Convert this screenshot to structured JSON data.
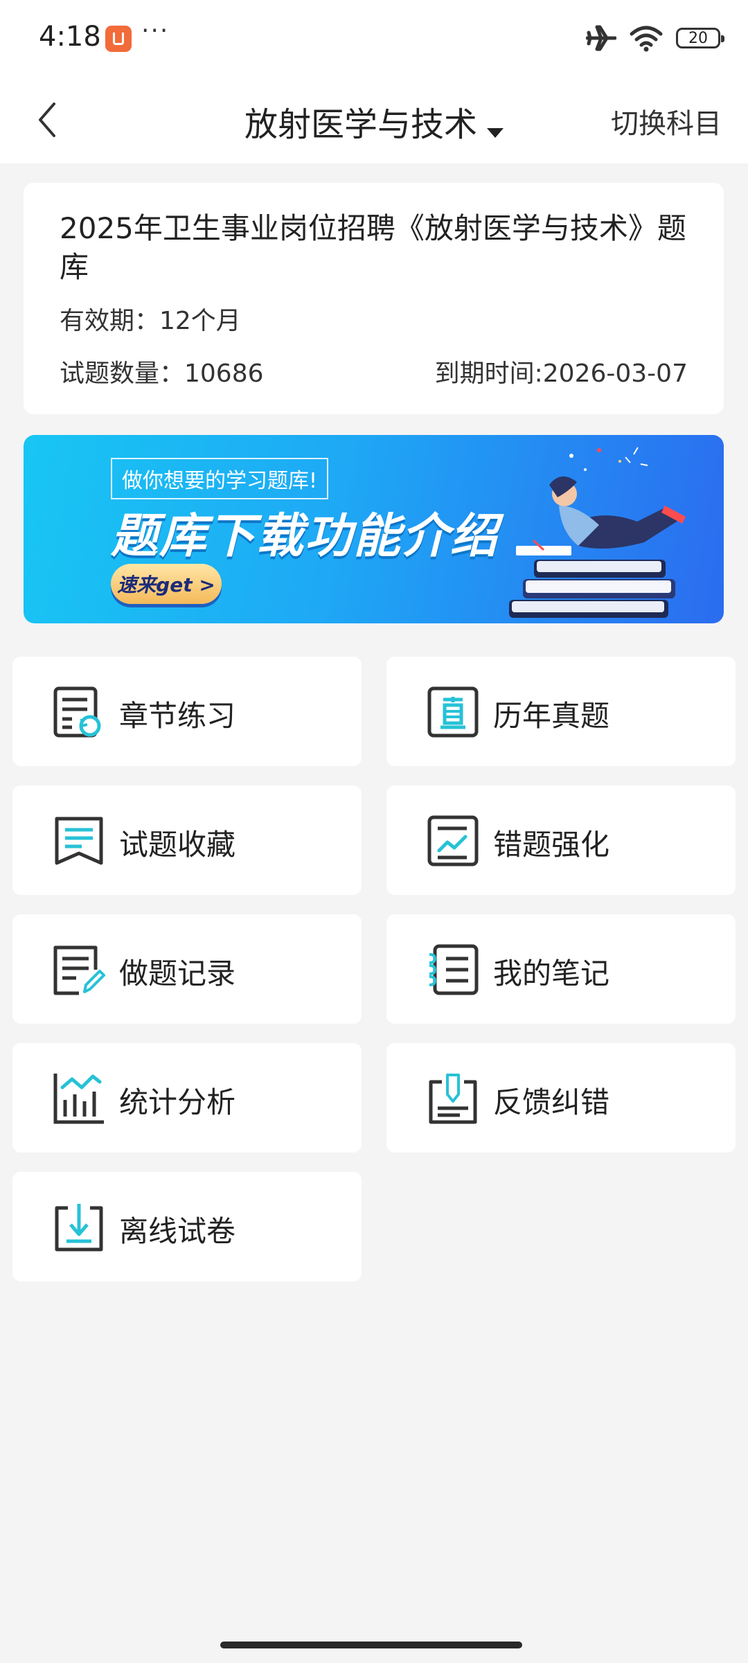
{
  "status_bar": {
    "time": "4:18",
    "dots": "···",
    "battery": "20"
  },
  "header": {
    "title": "放射医学与技术",
    "switch_label": "切换科目"
  },
  "info_card": {
    "title": "2025年卫生事业岗位招聘《放射医学与技术》题库",
    "validity": "有效期：12个月",
    "question_count": "试题数量：10686",
    "expiry": "到期时间:2026-03-07"
  },
  "banner": {
    "tag": "做你想要的学习题库!",
    "headline": "题库下载功能介绍",
    "button": "速来get >"
  },
  "menu": [
    {
      "label": "章节练习",
      "icon": "chapter-practice-icon"
    },
    {
      "label": "历年真题",
      "icon": "past-exams-icon"
    },
    {
      "label": "试题收藏",
      "icon": "favorites-icon"
    },
    {
      "label": "错题强化",
      "icon": "mistakes-icon"
    },
    {
      "label": "做题记录",
      "icon": "records-icon"
    },
    {
      "label": "我的笔记",
      "icon": "notes-icon"
    },
    {
      "label": "统计分析",
      "icon": "statistics-icon"
    },
    {
      "label": "反馈纠错",
      "icon": "feedback-icon"
    },
    {
      "label": "离线试卷",
      "icon": "offline-download-icon"
    }
  ],
  "colors": {
    "accent": "#26c2d6",
    "icon_stroke": "#333333",
    "page_bg": "#f4f4f5"
  }
}
